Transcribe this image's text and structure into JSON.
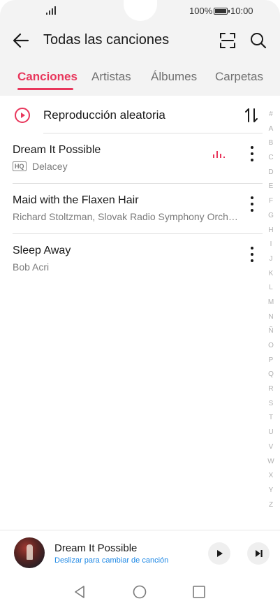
{
  "status_bar": {
    "battery_percent": "100%",
    "time": "10:00"
  },
  "header": {
    "title": "Todas las canciones",
    "back_icon": "back-arrow-icon",
    "scan_icon": "scan-icon",
    "search_icon": "search-icon"
  },
  "tabs": [
    {
      "label": "Canciones",
      "active": true
    },
    {
      "label": "Artistas",
      "active": false
    },
    {
      "label": "Álbumes",
      "active": false
    },
    {
      "label": "Carpetas",
      "active": false
    }
  ],
  "shuffle": {
    "label": "Reproducción aleatoria",
    "icon": "play-circle-icon",
    "sort_icon": "sort-icon"
  },
  "songs": [
    {
      "title": "Dream It Possible",
      "artist": "Delacey",
      "badge": "HQ",
      "playing": true
    },
    {
      "title": "Maid with the Flaxen Hair",
      "artist": "Richard Stoltzman, Slovak Radio Symphony Orchestra",
      "badge": "",
      "playing": false
    },
    {
      "title": "Sleep Away",
      "artist": "Bob Acri",
      "badge": "",
      "playing": false
    }
  ],
  "alphabet": [
    "#",
    "A",
    "B",
    "C",
    "D",
    "E",
    "F",
    "G",
    "H",
    "I",
    "J",
    "K",
    "L",
    "M",
    "N",
    "Ñ",
    "O",
    "P",
    "Q",
    "R",
    "S",
    "T",
    "U",
    "V",
    "W",
    "X",
    "Y",
    "Z"
  ],
  "now_playing": {
    "title": "Dream It Possible",
    "hint": "Deslizar para cambiar de canción",
    "play_icon": "play-icon",
    "next_icon": "skip-next-icon"
  },
  "colors": {
    "accent": "#e8375c",
    "hint": "#1e88e5",
    "header_bg": "#f3f3f3"
  }
}
